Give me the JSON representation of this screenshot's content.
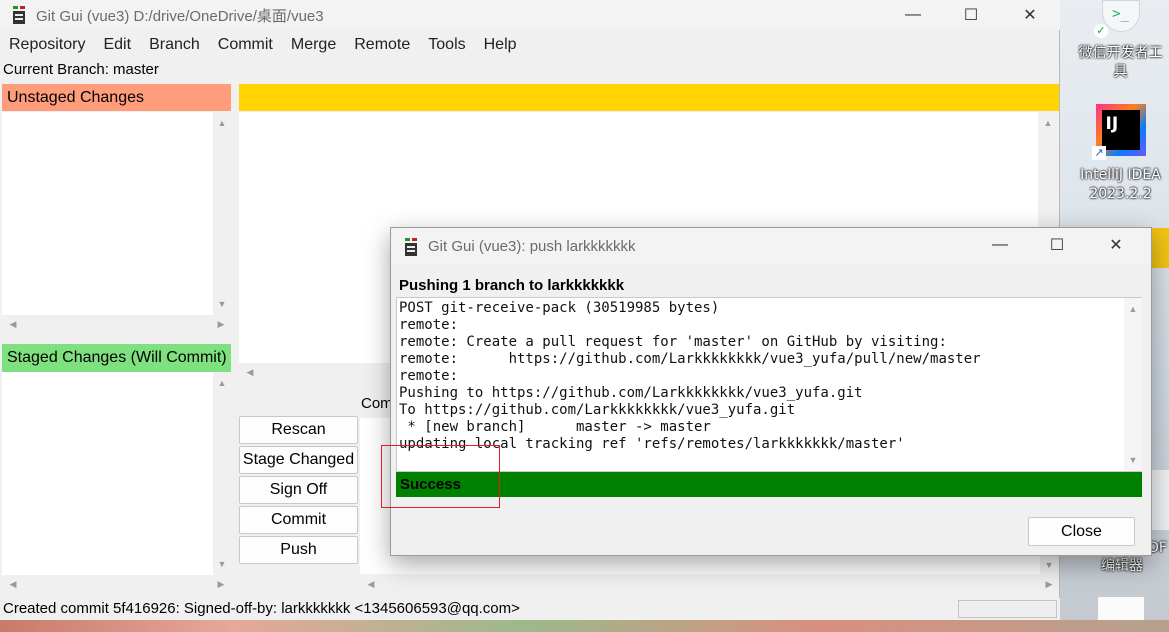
{
  "window": {
    "title": "Git Gui (vue3) D:/drive/OneDrive/桌面/vue3",
    "controls": {
      "minimize": "—",
      "maximize": "☐",
      "close": "✕"
    }
  },
  "menu": [
    "Repository",
    "Edit",
    "Branch",
    "Commit",
    "Merge",
    "Remote",
    "Tools",
    "Help"
  ],
  "current_branch": "Current Branch: master",
  "unstaged": {
    "header": "Unstaged Changes",
    "color": "#ff9c7b"
  },
  "staged": {
    "header": "Staged Changes (Will Commit)",
    "color": "#7fe07f"
  },
  "diff_header_color": "#ffd400",
  "commit_label_partial": "Com",
  "buttons": {
    "rescan": "Rescan",
    "stage_changed": "Stage Changed",
    "sign_off": "Sign Off",
    "commit": "Commit",
    "push": "Push"
  },
  "status": "Created commit 5f416926: Signed-off-by: larkkkkkkk <1345606593@qq.com>",
  "dialog": {
    "title": "Git Gui (vue3): push larkkkkkkk",
    "heading": "Pushing 1 branch to larkkkkkkk",
    "log": "POST git-receive-pack (30519985 bytes)\nremote:\nremote: Create a pull request for 'master' on GitHub by visiting:\nremote:      https://github.com/Larkkkkkkkk/vue3_yufa/pull/new/master\nremote:\nPushing to https://github.com/Larkkkkkkkk/vue3_yufa.git\nTo https://github.com/Larkkkkkkkk/vue3_yufa.git\n * [new branch]      master -> master\nupdating local tracking ref 'refs/remotes/larkkkkkkk/master'",
    "result": "Success",
    "result_color": "#008000",
    "close_label": "Close"
  },
  "desktop": {
    "icon1": "微信开发者工\n具",
    "icon2": "IntelliJ IDEA\n2023.2.2",
    "icon3": "编辑器",
    "partial_right_1": "n",
    "partial_right_2": "DF"
  }
}
